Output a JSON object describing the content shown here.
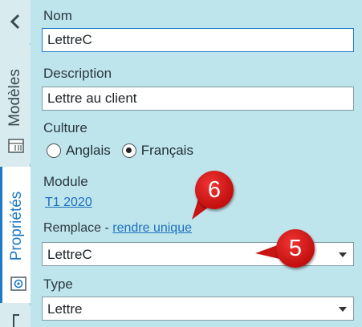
{
  "rail": {
    "collapse_icon": "chevron-left-icon",
    "tabs": [
      {
        "label": "Modèles",
        "icon": "template-icon",
        "active": false
      },
      {
        "label": "Propriétés",
        "icon": "properties-icon",
        "active": true
      }
    ]
  },
  "panel": {
    "name": {
      "label": "Nom",
      "value": "LettreC"
    },
    "description": {
      "label": "Description",
      "value": "Lettre au client"
    },
    "culture": {
      "label": "Culture",
      "options": [
        {
          "label": "Anglais",
          "selected": false
        },
        {
          "label": "Français",
          "selected": true
        }
      ]
    },
    "module": {
      "label": "Module",
      "link_text": "T1 2020"
    },
    "replaces": {
      "label": "Remplace - ",
      "link_text": "rendre unique",
      "value": "LettreC"
    },
    "type": {
      "label": "Type",
      "value": "Lettre"
    }
  },
  "callouts": [
    {
      "number": "6"
    },
    {
      "number": "5"
    }
  ],
  "colors": {
    "panel_background": "#bfe5ec",
    "active_tab_accent": "#1c7ac7",
    "link": "#1c6fc0",
    "callout": "#d41919"
  }
}
